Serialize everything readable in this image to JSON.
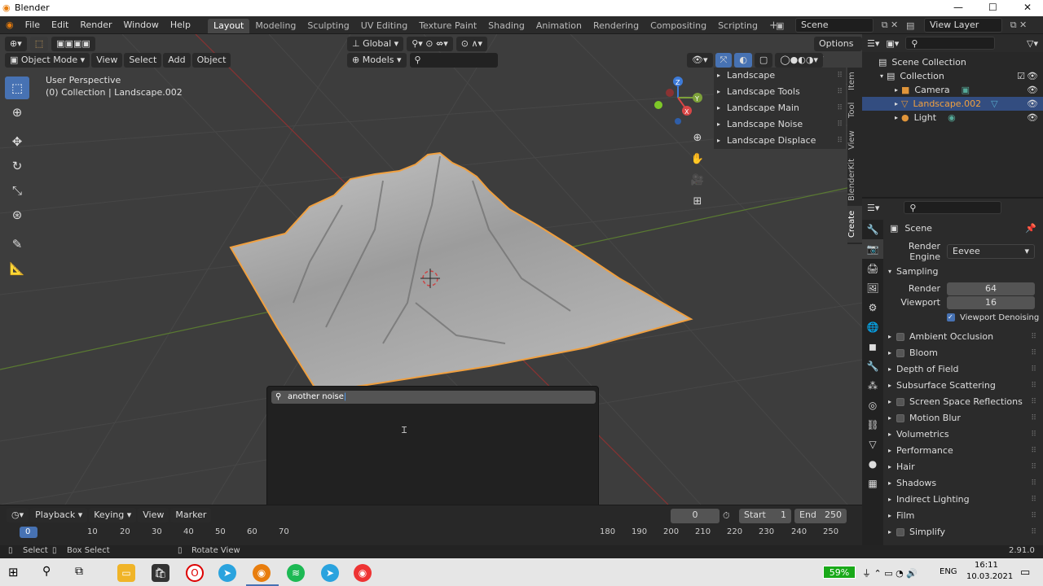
{
  "window": {
    "title": "Blender"
  },
  "menubar": {
    "file": "File",
    "edit": "Edit",
    "render": "Render",
    "window": "Window",
    "help": "Help"
  },
  "workspaces": [
    "Layout",
    "Modeling",
    "Sculpting",
    "UV Editing",
    "Texture Paint",
    "Shading",
    "Animation",
    "Rendering",
    "Compositing",
    "Scripting"
  ],
  "scene": {
    "name": "Scene",
    "view_layer": "View Layer"
  },
  "header": {
    "orientation": "Global",
    "options": "Options",
    "models": "Models"
  },
  "viewport_menu": {
    "mode": "Object Mode",
    "view": "View",
    "select": "Select",
    "add": "Add",
    "object": "Object"
  },
  "viewport_info": {
    "perspective": "User Perspective",
    "collection": "(0) Collection | Landscape.002"
  },
  "npanel": {
    "items": [
      "Landscape",
      "Landscape Tools",
      "Landscape Main",
      "Landscape Noise",
      "Landscape Displace"
    ],
    "tabs": [
      "Item",
      "Tool",
      "View",
      "BlenderKit",
      "Create"
    ]
  },
  "outliner": {
    "root": "Scene Collection",
    "collection": "Collection",
    "items": [
      "Camera",
      "Landscape.002",
      "Light"
    ]
  },
  "properties": {
    "scene_label": "Scene",
    "render_engine_label": "Render Engine",
    "render_engine": "Eevee",
    "sampling": "Sampling",
    "render_label": "Render",
    "render_value": "64",
    "viewport_label": "Viewport",
    "viewport_value": "16",
    "denoising": "Viewport Denoising",
    "sections": [
      {
        "label": "Ambient Occlusion",
        "check": true
      },
      {
        "label": "Bloom",
        "check": true
      },
      {
        "label": "Depth of Field",
        "check": false
      },
      {
        "label": "Subsurface Scattering",
        "check": false
      },
      {
        "label": "Screen Space Reflections",
        "check": true
      },
      {
        "label": "Motion Blur",
        "check": true
      },
      {
        "label": "Volumetrics",
        "check": false
      },
      {
        "label": "Performance",
        "check": false
      },
      {
        "label": "Hair",
        "check": false
      },
      {
        "label": "Shadows",
        "check": false
      },
      {
        "label": "Indirect Lighting",
        "check": false
      },
      {
        "label": "Film",
        "check": false
      },
      {
        "label": "Simplify",
        "check": true
      }
    ]
  },
  "search": {
    "query": "another noise"
  },
  "timeline": {
    "playback": "Playback",
    "keying": "Keying",
    "view": "View",
    "marker": "Marker",
    "current_frame": "0",
    "start_label": "Start",
    "start": "1",
    "end_label": "End",
    "end": "250",
    "ticks": [
      "0",
      "10",
      "20",
      "30",
      "40",
      "50",
      "60",
      "70",
      "180",
      "190",
      "200",
      "210",
      "220",
      "230",
      "240",
      "250"
    ]
  },
  "statusbar": {
    "select": "Select",
    "box_select": "Box Select",
    "rotate_view": "Rotate View",
    "version": "2.91.0"
  },
  "taskbar": {
    "battery": "59%",
    "lang": "ENG",
    "time": "16:11",
    "date": "10.03.2021"
  },
  "colors": {
    "accent": "#4772b3",
    "selection": "#334d80",
    "object_outline": "#f0a040"
  }
}
